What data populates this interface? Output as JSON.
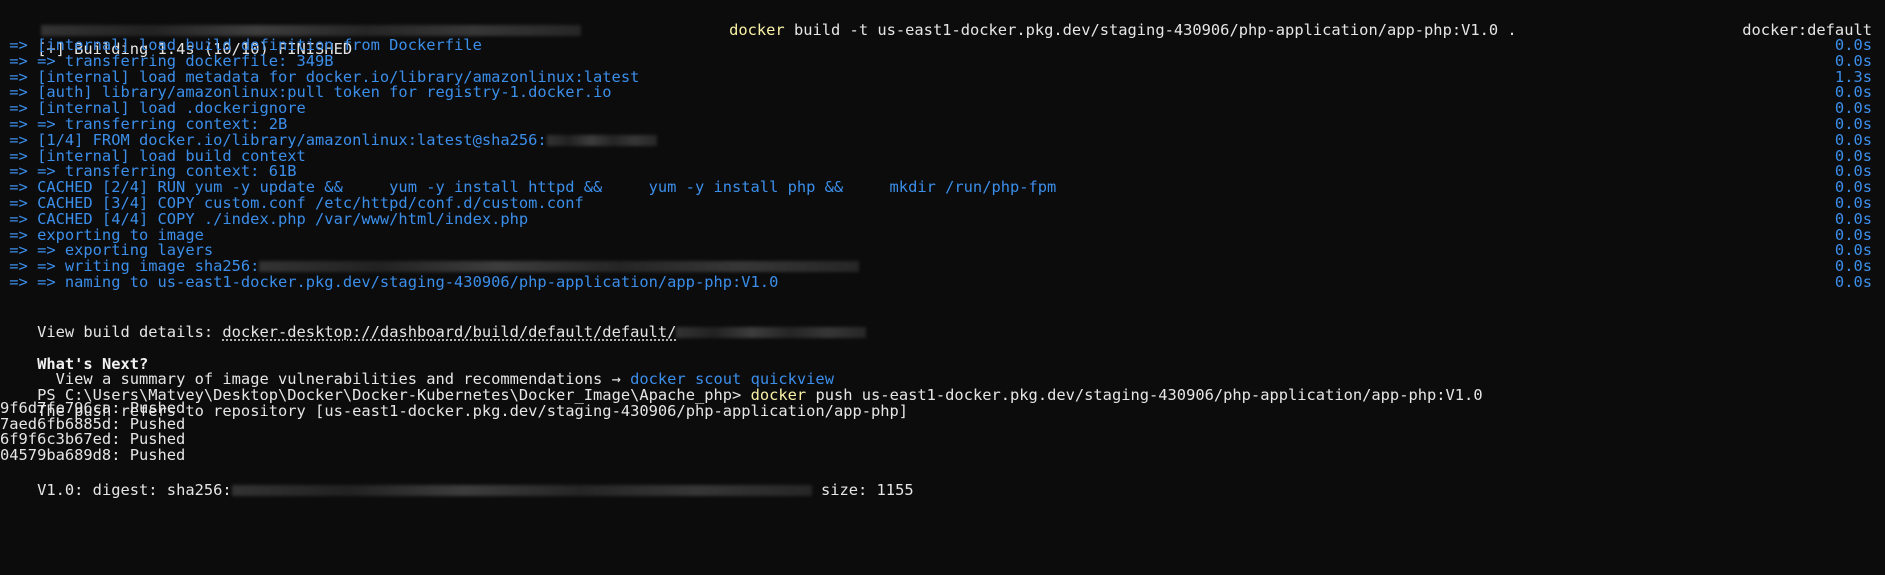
{
  "colors": {
    "background": "#0c0c0c",
    "text": "#cccccc",
    "progress": "#3b8eea",
    "command": "#f9f1a5"
  },
  "header": {
    "cmd_word": "docker",
    "cmd_args": " build -t us-east1-docker.pkg.dev/staging-430906/php-application/app-php:V1.0 ."
  },
  "build": {
    "status": "[+] Building 1.4s (10/10) FINISHED",
    "context": "docker:default",
    "steps": [
      {
        "text": " => [internal] load build definition from Dockerfile",
        "time": "0.0s"
      },
      {
        "text": " => => transferring dockerfile: 349B",
        "time": "0.0s"
      },
      {
        "text": " => [internal] load metadata for docker.io/library/amazonlinux:latest",
        "time": "1.3s"
      },
      {
        "text": " => [auth] library/amazonlinux:pull token for registry-1.docker.io",
        "time": "0.0s"
      },
      {
        "text": " => [internal] load .dockerignore",
        "time": "0.0s"
      },
      {
        "text": " => => transferring context: 2B",
        "time": "0.0s"
      },
      {
        "text": " => [1/4] FROM docker.io/library/amazonlinux:latest@sha256:",
        "time": "0.0s"
      },
      {
        "text": " => [internal] load build context",
        "time": "0.0s"
      },
      {
        "text": " => => transferring context: 61B",
        "time": "0.0s"
      },
      {
        "text": " => CACHED [2/4] RUN yum -y update &&     yum -y install httpd &&     yum -y install php &&     mkdir /run/php-fpm",
        "time": "0.0s"
      },
      {
        "text": " => CACHED [3/4] COPY custom.conf /etc/httpd/conf.d/custom.conf",
        "time": "0.0s"
      },
      {
        "text": " => CACHED [4/4] COPY ./index.php /var/www/html/index.php",
        "time": "0.0s"
      },
      {
        "text": " => exporting to image",
        "time": "0.0s"
      },
      {
        "text": " => => exporting layers",
        "time": "0.0s"
      },
      {
        "text": " => => writing image sha256:",
        "time": "0.0s"
      },
      {
        "text": " => => naming to us-east1-docker.pkg.dev/staging-430906/php-application/app-php:V1.0",
        "time": "0.0s"
      }
    ]
  },
  "details": {
    "label": "View build details: ",
    "link": "docker-desktop://dashboard/build/default/default/"
  },
  "next": {
    "heading": "What's Next?",
    "summary": "  View a summary of image vulnerabilities and recommendations → ",
    "cmd": "docker scout quickview"
  },
  "push": {
    "prompt": "PS C:\\Users\\Matvey\\Desktop\\Docker\\Docker-Kubernetes\\Docker_Image\\Apache_php> ",
    "cmd_word": "docker",
    "cmd_args": " push us-east1-docker.pkg.dev/staging-430906/php-application/app-php:V1.0",
    "refers": "The push refers to repository [us-east1-docker.pkg.dev/staging-430906/php-application/app-php]",
    "layers": [
      "9f6d7fe796ca: Pushed",
      "7aed6fb6885d: Pushed",
      "6f9f6c3b67ed: Pushed",
      "04579ba689d8: Pushed"
    ],
    "digest_label": "V1.0: digest: sha256:",
    "size": " size: 1155"
  }
}
